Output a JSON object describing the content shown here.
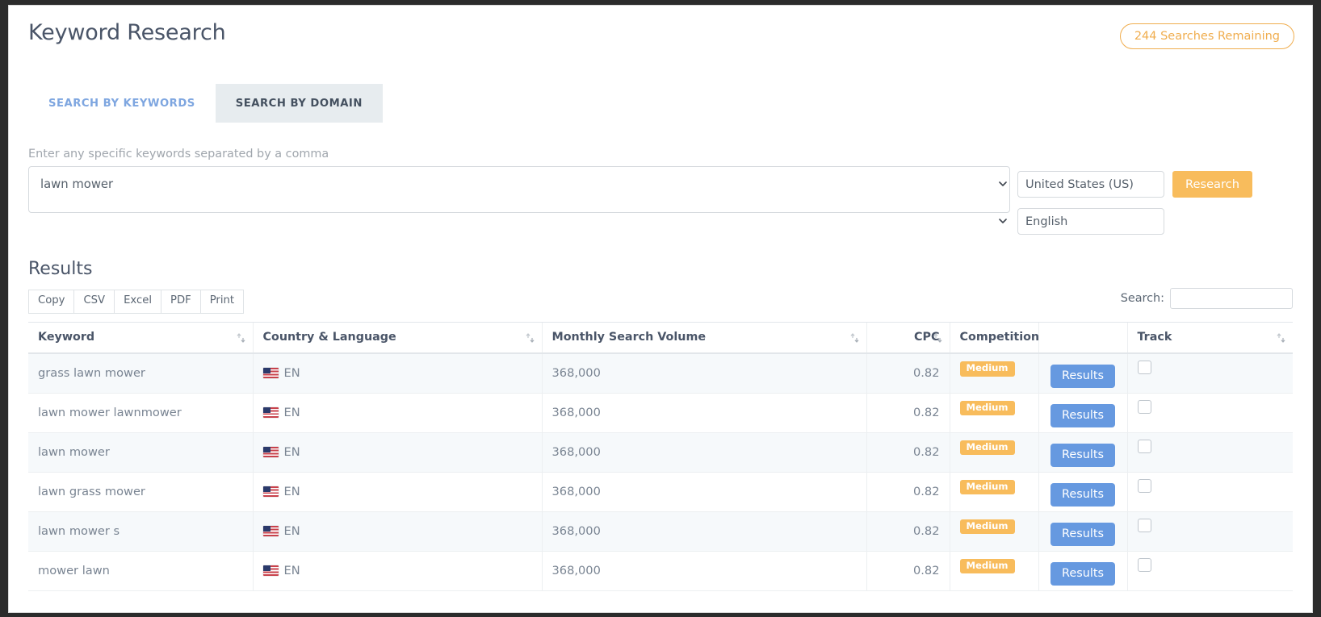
{
  "header": {
    "title": "Keyword Research",
    "searches_badge": "244 Searches Remaining"
  },
  "tabs": [
    {
      "label": "SEARCH BY KEYWORDS",
      "active": false
    },
    {
      "label": "SEARCH BY DOMAIN",
      "active": true
    }
  ],
  "form": {
    "hint": "Enter any specific keywords separated by a comma",
    "keywords_value": "lawn mower",
    "keywords_placeholder": "",
    "country_selected": "United States (US)",
    "country_options": [
      "United States (US)"
    ],
    "language_selected": "English",
    "language_options": [
      "English"
    ],
    "research_button": "Research"
  },
  "results": {
    "title": "Results",
    "export_buttons": [
      "Copy",
      "CSV",
      "Excel",
      "PDF",
      "Print"
    ],
    "search_label": "Search:",
    "search_value": "",
    "search_placeholder": "",
    "columns": [
      {
        "label": "Keyword",
        "sortable": true,
        "align": "left"
      },
      {
        "label": "Country & Language",
        "sortable": true,
        "align": "left"
      },
      {
        "label": "Monthly Search Volume",
        "sortable": true,
        "align": "left"
      },
      {
        "label": "CPC",
        "sortable": true,
        "align": "right"
      },
      {
        "label": "Competition",
        "sortable": false,
        "align": "left"
      },
      {
        "label": "",
        "sortable": false,
        "align": "center"
      },
      {
        "label": "Track",
        "sortable": true,
        "align": "left"
      }
    ],
    "rows": [
      {
        "keyword": "grass lawn mower",
        "language": "EN",
        "flag": "us-flag-icon",
        "volume": "368,000",
        "cpc": "0.82",
        "competition": "Medium",
        "action": "Results",
        "tracked": false
      },
      {
        "keyword": "lawn mower lawnmower",
        "language": "EN",
        "flag": "us-flag-icon",
        "volume": "368,000",
        "cpc": "0.82",
        "competition": "Medium",
        "action": "Results",
        "tracked": false
      },
      {
        "keyword": "lawn mower",
        "language": "EN",
        "flag": "us-flag-icon",
        "volume": "368,000",
        "cpc": "0.82",
        "competition": "Medium",
        "action": "Results",
        "tracked": false
      },
      {
        "keyword": "lawn grass mower",
        "language": "EN",
        "flag": "us-flag-icon",
        "volume": "368,000",
        "cpc": "0.82",
        "competition": "Medium",
        "action": "Results",
        "tracked": false
      },
      {
        "keyword": "lawn mower s",
        "language": "EN",
        "flag": "us-flag-icon",
        "volume": "368,000",
        "cpc": "0.82",
        "competition": "Medium",
        "action": "Results",
        "tracked": false
      },
      {
        "keyword": "mower lawn",
        "language": "EN",
        "flag": "us-flag-icon",
        "volume": "368,000",
        "cpc": "0.82",
        "competition": "Medium",
        "action": "Results",
        "tracked": false
      }
    ]
  },
  "colors": {
    "accent_orange": "#f8bc5c",
    "accent_blue": "#6699e0",
    "tab_link_blue": "#7ea6e0",
    "text_dark": "#4a5568",
    "text_muted": "#798492",
    "row_stripe": "#f6f9fb"
  }
}
